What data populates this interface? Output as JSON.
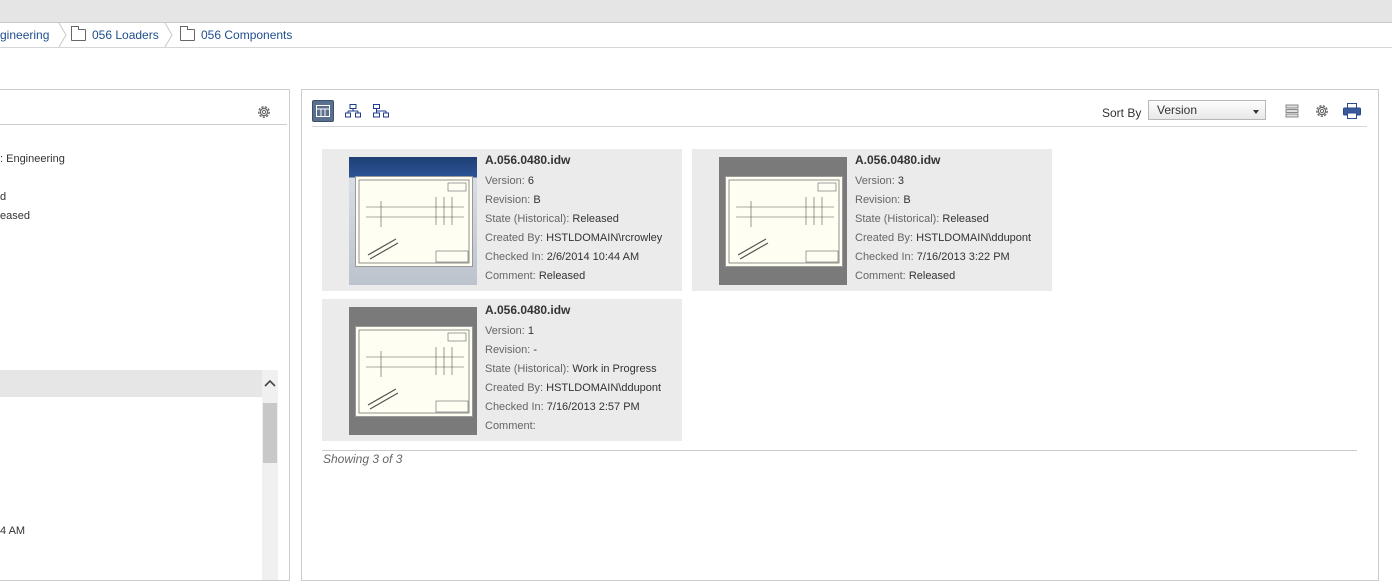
{
  "breadcrumb": {
    "items": [
      {
        "label": "gineering"
      },
      {
        "label": "056 Loaders"
      },
      {
        "label": "056 Components"
      }
    ]
  },
  "left_panel": {
    "lines": [
      ": Engineering",
      "d",
      "eased",
      "4 AM"
    ]
  },
  "toolbar": {
    "sort_label": "Sort By",
    "sort_value": "Version"
  },
  "labels": {
    "version": "Version:",
    "revision": "Revision:",
    "state": "State (Historical):",
    "created_by": "Created By:",
    "checked_in": "Checked In:",
    "comment": "Comment:"
  },
  "cards": [
    {
      "title": "A.056.0480.idw",
      "version": "6",
      "revision": "B",
      "state": "Released",
      "created_by": "HSTLDOMAIN\\rcrowley",
      "checked_in": "2/6/2014 10:44 AM",
      "comment": "Released"
    },
    {
      "title": "A.056.0480.idw",
      "version": "3",
      "revision": "B",
      "state": "Released",
      "created_by": "HSTLDOMAIN\\ddupont",
      "checked_in": "7/16/2013 3:22 PM",
      "comment": "Released"
    },
    {
      "title": "A.056.0480.idw",
      "version": "1",
      "revision": "-",
      "state": "Work in Progress",
      "created_by": "HSTLDOMAIN\\ddupont",
      "checked_in": "7/16/2013 2:57 PM",
      "comment": ""
    }
  ],
  "footer": {
    "showing": "Showing 3 of 3"
  }
}
